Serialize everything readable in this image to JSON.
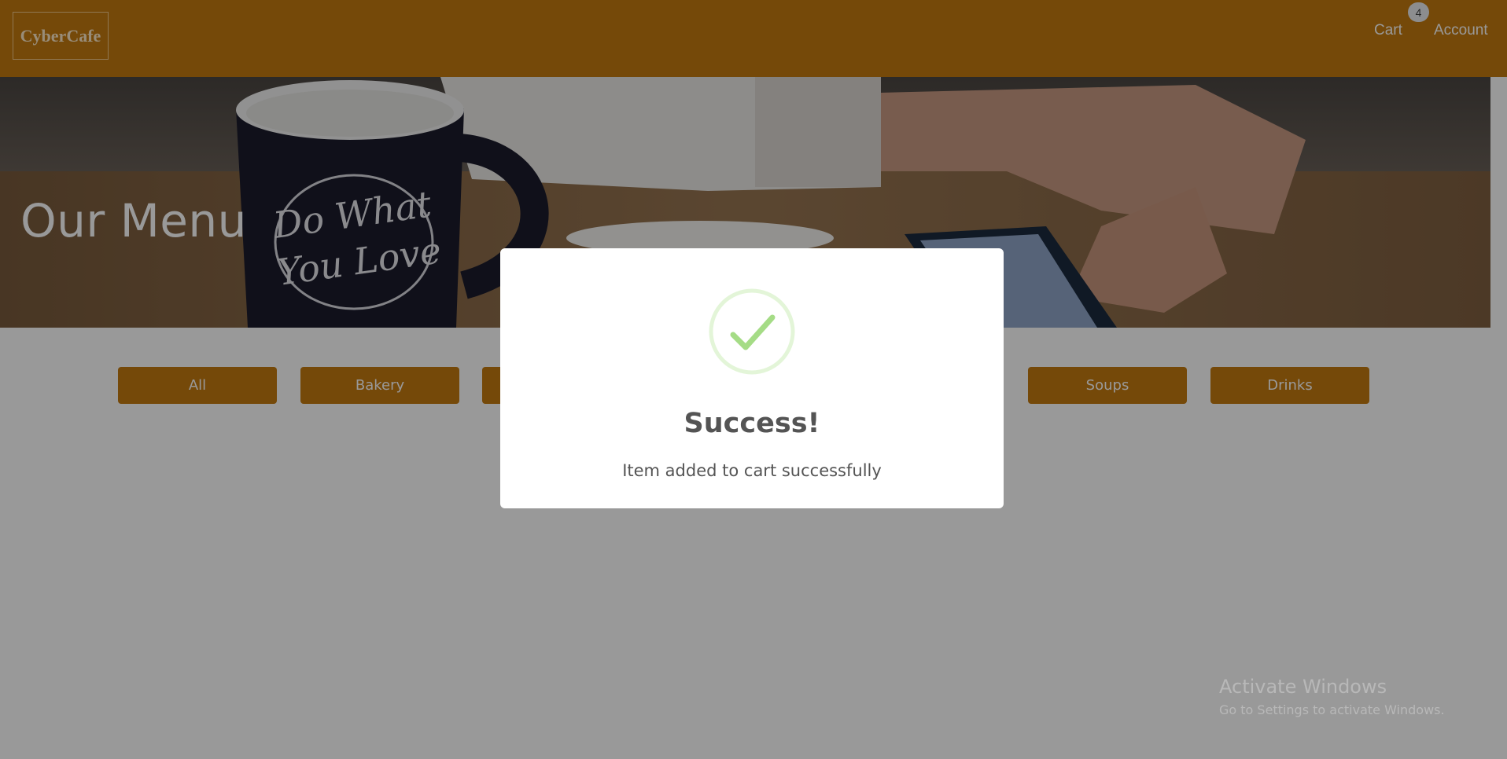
{
  "brand": {
    "logo_text": "CyberCafe"
  },
  "nav": {
    "cart_label": "Cart",
    "cart_count": "4",
    "account_label": "Account"
  },
  "hero": {
    "title": "Our Menu",
    "mug_text_line1": "Do What",
    "mug_text_line2": "You Love"
  },
  "categories": [
    {
      "label": "All"
    },
    {
      "label": "Bakery"
    },
    {
      "label": ""
    },
    {
      "label": ""
    },
    {
      "label": ""
    },
    {
      "label": "Soups"
    },
    {
      "label": "Drinks"
    }
  ],
  "modal": {
    "title": "Success!",
    "message": "Item added to cart successfully"
  },
  "watermark": {
    "title": "Activate Windows",
    "subtitle": "Go to Settings to activate Windows."
  },
  "colors": {
    "brand": "#c47a10",
    "success_check": "#a5dc86",
    "overlay": "rgba(0,0,0,0.4)"
  },
  "icons": {
    "success": "check-circle-icon"
  }
}
